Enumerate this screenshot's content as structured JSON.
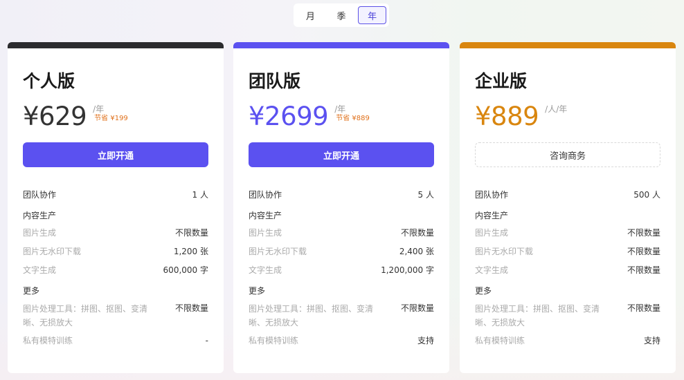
{
  "period_tabs": [
    {
      "label": "月",
      "active": false
    },
    {
      "label": "季",
      "active": false
    },
    {
      "label": "年",
      "active": true
    }
  ],
  "colors": {
    "accent": "#5b51f0",
    "personal_bar": "#2b2b2e",
    "team_bar": "#5b51f0",
    "enterprise_bar": "#d9860f",
    "personal_price": "#333333",
    "team_price": "#5b51f0",
    "enterprise_price": "#d9860f",
    "save_text": "#e0701a"
  },
  "plans": [
    {
      "name": "个人版",
      "price": "¥629",
      "per": "/年",
      "save": "节省 ¥199",
      "cta": "立即开通",
      "team_label": "团队协作",
      "team_value": "1 人",
      "section_content": "内容生产",
      "image_gen_label": "图片生成",
      "image_gen_value": "不限数量",
      "watermark_label": "图片无水印下载",
      "watermark_value": "1,200 张",
      "text_gen_label": "文字生成",
      "text_gen_value": "600,000 字",
      "section_more": "更多",
      "tools_label": "图片处理工具：拼图、抠图、变清晰、无损放大",
      "tools_value": "不限数量",
      "model_label": "私有模特训练",
      "model_value": "-"
    },
    {
      "name": "团队版",
      "price": "¥2699",
      "per": "/年",
      "save": "节省 ¥889",
      "cta": "立即开通",
      "team_label": "团队协作",
      "team_value": "5 人",
      "section_content": "内容生产",
      "image_gen_label": "图片生成",
      "image_gen_value": "不限数量",
      "watermark_label": "图片无水印下载",
      "watermark_value": "2,400 张",
      "text_gen_label": "文字生成",
      "text_gen_value": "1,200,000 字",
      "section_more": "更多",
      "tools_label": "图片处理工具：拼图、抠图、变清晰、无损放大",
      "tools_value": "不限数量",
      "model_label": "私有模特训练",
      "model_value": "支持"
    },
    {
      "name": "企业版",
      "price": "¥889",
      "per": "/人/年",
      "save": "",
      "cta": "咨询商务",
      "team_label": "团队协作",
      "team_value": "500 人",
      "section_content": "内容生产",
      "image_gen_label": "图片生成",
      "image_gen_value": "不限数量",
      "watermark_label": "图片无水印下载",
      "watermark_value": "不限数量",
      "text_gen_label": "文字生成",
      "text_gen_value": "不限数量",
      "section_more": "更多",
      "tools_label": "图片处理工具：拼图、抠图、变清晰、无损放大",
      "tools_value": "不限数量",
      "model_label": "私有模特训练",
      "model_value": "支持"
    }
  ]
}
